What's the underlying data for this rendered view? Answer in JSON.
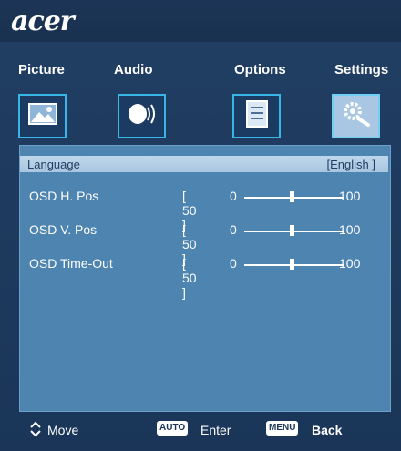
{
  "brand": "acer",
  "tabs": [
    {
      "label": "Picture",
      "icon": "picture-icon"
    },
    {
      "label": "Audio",
      "icon": "audio-icon"
    },
    {
      "label": "Options",
      "icon": "options-icon"
    },
    {
      "label": "Settings",
      "icon": "settings-icon"
    }
  ],
  "language": {
    "label": "Language",
    "value": "[English ]"
  },
  "settings": [
    {
      "label": "OSD H. Pos",
      "value": "[ 50 ]",
      "min": "0",
      "max": "100",
      "level": 50
    },
    {
      "label": "OSD V. Pos",
      "value": "[ 50 ]",
      "min": "0",
      "max": "100",
      "level": 50
    },
    {
      "label": "OSD Time-Out",
      "value": "[ 50 ]",
      "min": "0",
      "max": "100",
      "level": 50
    }
  ],
  "footer": {
    "move_label": "Move",
    "auto_badge": "AUTO",
    "enter_label": "Enter",
    "menu_badge": "MENU",
    "back_label": "Back"
  },
  "colors": {
    "accent": "#38b7e6",
    "panel": "#4d84b0",
    "frame": "#213f64"
  }
}
